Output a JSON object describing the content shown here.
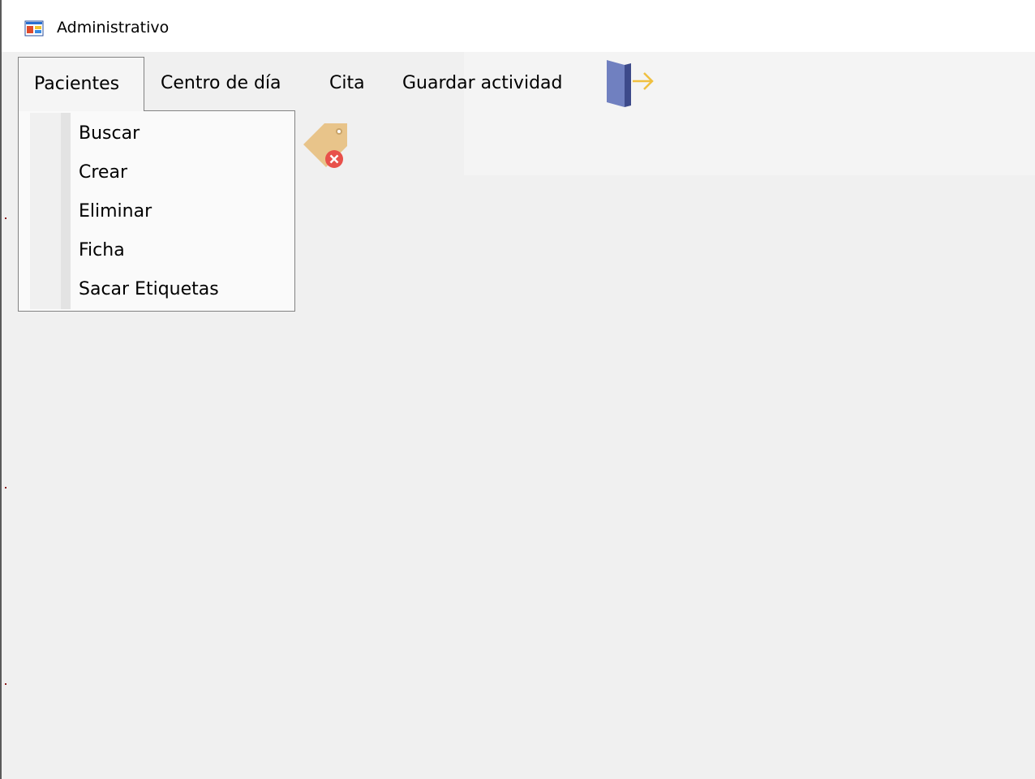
{
  "window": {
    "title": "Administrativo",
    "icon": "app-window-icon"
  },
  "menubar": {
    "items": [
      {
        "label": "Pacientes",
        "open": true
      },
      {
        "label": "Centro de día",
        "open": false
      },
      {
        "label": "Cita",
        "open": false
      },
      {
        "label": "Guardar actividad",
        "open": false
      }
    ],
    "exit_icon": "exit-door-icon"
  },
  "dropdown": {
    "parent": "Pacientes",
    "items": [
      {
        "label": "Buscar"
      },
      {
        "label": "Crear"
      },
      {
        "label": "Eliminar"
      },
      {
        "label": "Ficha"
      },
      {
        "label": "Sacar Etiquetas"
      }
    ]
  },
  "toolbar": {
    "tag_icon": "tag-remove-icon"
  },
  "colors": {
    "background": "#f0f0f0",
    "titlebar": "#ffffff",
    "dropdown_bg": "#fafafa",
    "border": "#828282",
    "door": "#6f7fbf",
    "arrow": "#f0c040",
    "tag": "#e8c48a",
    "remove_badge": "#e8504a"
  }
}
